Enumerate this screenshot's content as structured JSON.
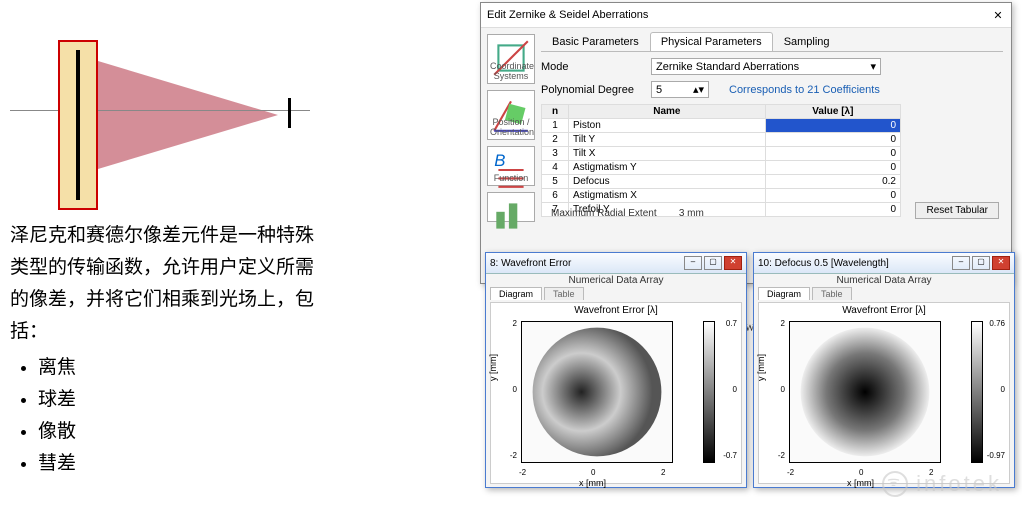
{
  "description": {
    "paragraph": "泽尼克和赛德尔像差元件是一种特殊类型的传输函数，允许用户定义所需的像差，并将它们相乘到光场上，包括：",
    "bullets": [
      "离焦",
      "球差",
      "像散",
      "彗差"
    ]
  },
  "dialog": {
    "title": "Edit Zernike & Seidel Aberrations",
    "close": "✕",
    "tabs": [
      "Basic Parameters",
      "Physical Parameters",
      "Sampling"
    ],
    "active_tab": 1,
    "sidebar": [
      "Coordinate Systems",
      "Position / Orientation",
      "Function"
    ],
    "mode_label": "Mode",
    "mode_value": "Zernike Standard Aberrations",
    "degree_label": "Polynomial Degree",
    "degree_value": "5",
    "coeff_link": "Corresponds to 21 Coefficients",
    "table_headers": [
      "n",
      "Name",
      "Value [λ]"
    ],
    "rows": [
      {
        "n": "1",
        "name": "Piston",
        "v": "0",
        "sel": true
      },
      {
        "n": "2",
        "name": "Tilt Y",
        "v": "0"
      },
      {
        "n": "3",
        "name": "Tilt X",
        "v": "0"
      },
      {
        "n": "4",
        "name": "Astigmatism Y",
        "v": "0"
      },
      {
        "n": "5",
        "name": "Defocus",
        "v": "0.2"
      },
      {
        "n": "6",
        "name": "Astigmatism X",
        "v": "0"
      },
      {
        "n": "7",
        "name": "Trefoil Y",
        "v": "0"
      }
    ],
    "extent_label": "Maximum Radial Extent",
    "extent_value": "3 mm",
    "reset": "Reset Tabular",
    "wavelength_label": "Wavelength"
  },
  "chart_data": [
    {
      "type": "heatmap",
      "window_title": "8: Wavefront Error",
      "subtitle": "Numerical Data Array",
      "tabs": [
        "Diagram",
        "Table"
      ],
      "title": "Wavefront Error [λ]",
      "xlabel": "x [mm]",
      "ylabel": "y [mm]",
      "xlim": [
        -2,
        2
      ],
      "ylim": [
        -2,
        2
      ],
      "xticks": [
        -2,
        0,
        2
      ],
      "yticks": [
        -2,
        0,
        2
      ],
      "cbar_ticks": [
        0.7,
        0,
        -0.7
      ],
      "style": "coma"
    },
    {
      "type": "heatmap",
      "window_title": "10: Defocus 0.5 [Wavelength]",
      "subtitle": "Numerical Data Array",
      "tabs": [
        "Diagram",
        "Table"
      ],
      "title": "Wavefront Error [λ]",
      "xlabel": "x [mm]",
      "ylabel": "y [mm]",
      "xlim": [
        -2,
        2
      ],
      "ylim": [
        -2,
        2
      ],
      "xticks": [
        -2,
        0,
        2
      ],
      "yticks": [
        -2,
        0,
        2
      ],
      "cbar_ticks": [
        0.76,
        0,
        -0.97
      ],
      "style": "defocus"
    }
  ],
  "watermark": "infotek"
}
